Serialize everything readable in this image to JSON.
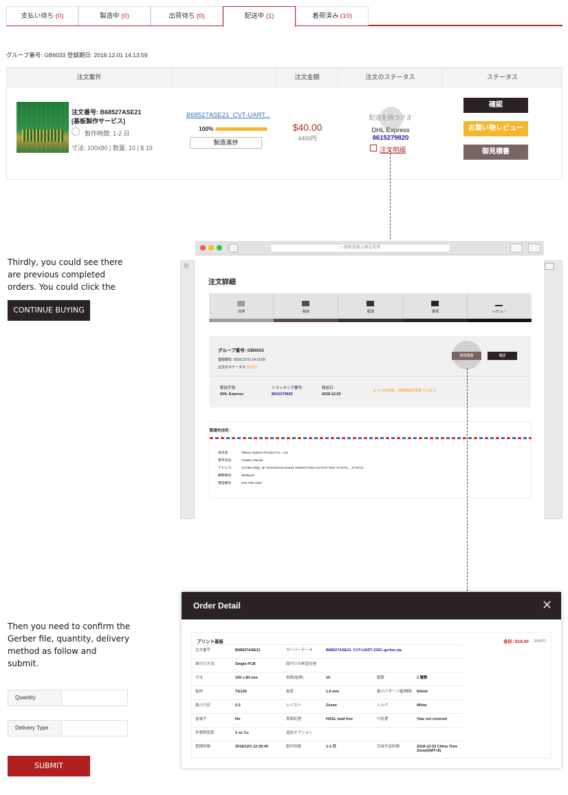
{
  "tabs": [
    {
      "label": "支払い待ち",
      "count": "(0)"
    },
    {
      "label": "製造中",
      "count": "(0)"
    },
    {
      "label": "出荷待ち",
      "count": "(0)"
    },
    {
      "label": "配送中",
      "count": "(1)"
    },
    {
      "label": "着荷済み",
      "count": "(10)"
    }
  ],
  "group_line": "グループ番号: GB6033 登録期日: 2018.12.01 14:13:59",
  "table": {
    "headers": [
      "注文案件",
      "",
      "注文金額",
      "注文のステータス",
      "ステータス"
    ],
    "order_no": "注文番号: B68527ASE21",
    "service": "[基板製作サービス]",
    "lead_time": "製作時間: 1-2 日",
    "size_line": "寸法: 100x80 | 数量: 10 | $ 19",
    "file_link": "B68527ASE21_CVT-UART...",
    "progress_pct": "100%",
    "progress_value": 100,
    "progress_btn": "製造進捗",
    "amount": "$40.00",
    "amount_yen": "4400円",
    "status_wait": "配達を待つさま",
    "carrier": "DHL Express",
    "tracking": "8615279820",
    "detail_link": "注文明細",
    "btn_confirm": "確認",
    "btn_review": "お買い物レビュー",
    "btn_quote": "御見積書"
  },
  "instructions": {
    "para1": [
      "Thirdly, you could see there",
      "are previous completed",
      "orders. You could click the"
    ],
    "continue_btn": "CONTINUE BUYING",
    "para2": [
      "Then you need to confirm the",
      "Gerber file, quantity, delivery",
      "method as follow and",
      "submit."
    ]
  },
  "form": {
    "quantity_label": "Quantity",
    "delivery_label": "Delivery Type",
    "submit": "SUBMIT"
  },
  "browser": {
    "search_placeholder": "搜索或输入网址名称",
    "title": "注文詳細",
    "steps": [
      "決済",
      "製造",
      "配送",
      "督領",
      "レビュー"
    ],
    "group_no": "グループ番号: GB6033",
    "reg_date": "登録期日: 2018.12.01 14:13:59",
    "status_label": "注文のステータス:",
    "status_value": "配送中",
    "btn_quote": "御見積書",
    "btn_confirm": "確認",
    "ship_method_label": "配送手段:",
    "ship_method": "DHL Express",
    "tracking_label": "トラッキング番号:",
    "tracking": "8615279820",
    "ship_date_label": "発送日:",
    "ship_date": "2018.12.03",
    "warning": "1～3日間後、追跡情報が更新されます。",
    "addr_title": "配達先住所 :",
    "addr": [
      {
        "k": "会社名:",
        "v": "Taihos System Product Co., Ltd."
      },
      {
        "k": "英字氏名:",
        "v": "Yusaku Okuda"
      },
      {
        "k": "アドレス:",
        "v": "OYABU bldg. 3F DAIKOKUCHO234 SIMOGYOKU KYOTO Pref, KYOTO, , KYOTO"
      },
      {
        "k": "郵便番号:",
        "v": "6008223"
      },
      {
        "k": "電話番号:",
        "v": "075-708-3162"
      }
    ]
  },
  "modal": {
    "title": "Order Detail",
    "section": "プリント基板",
    "total": "合計: $19.00",
    "total_yen": "2090円",
    "rows": [
      [
        "注文番号",
        "B68527ASE21",
        "ガーバーデータ",
        "B68527ASE21_CVT-UART-232C-gerber.zip",
        "",
        ""
      ],
      [
        "面付け方法：",
        "Single PCB",
        "面付けの希望仕様",
        "",
        "",
        ""
      ],
      [
        "寸法",
        "100 x 80 mm",
        "枚数(組数)",
        "10",
        "層数",
        "2 層数"
      ],
      [
        "板材",
        "TG130",
        "板厚",
        "1.6 mm",
        "最小パターン幅/間隔",
        "6/6mil"
      ],
      [
        "最小穴径",
        "0.3",
        "レジスト",
        "Green",
        "シルク",
        "White"
      ],
      [
        "金端子",
        "No",
        "表面処理",
        "HASL lead free",
        "穴処理",
        "Vias not covered"
      ],
      [
        "外層銅箔厚",
        "1 oz Cu",
        "追加オプション",
        "",
        "",
        ""
      ],
      [
        "登録時間",
        "2018/12/1 12:30:45",
        "製作時間",
        "1-2 日",
        "完成予定時間",
        "2018-12-02 China Time Zone(GMT+8)"
      ]
    ]
  },
  "colors": {
    "accent": "#b32626",
    "dark": "#2b2323",
    "amber": "#f7b52c",
    "taupe": "#7a6565",
    "link": "#1a1aa6"
  }
}
